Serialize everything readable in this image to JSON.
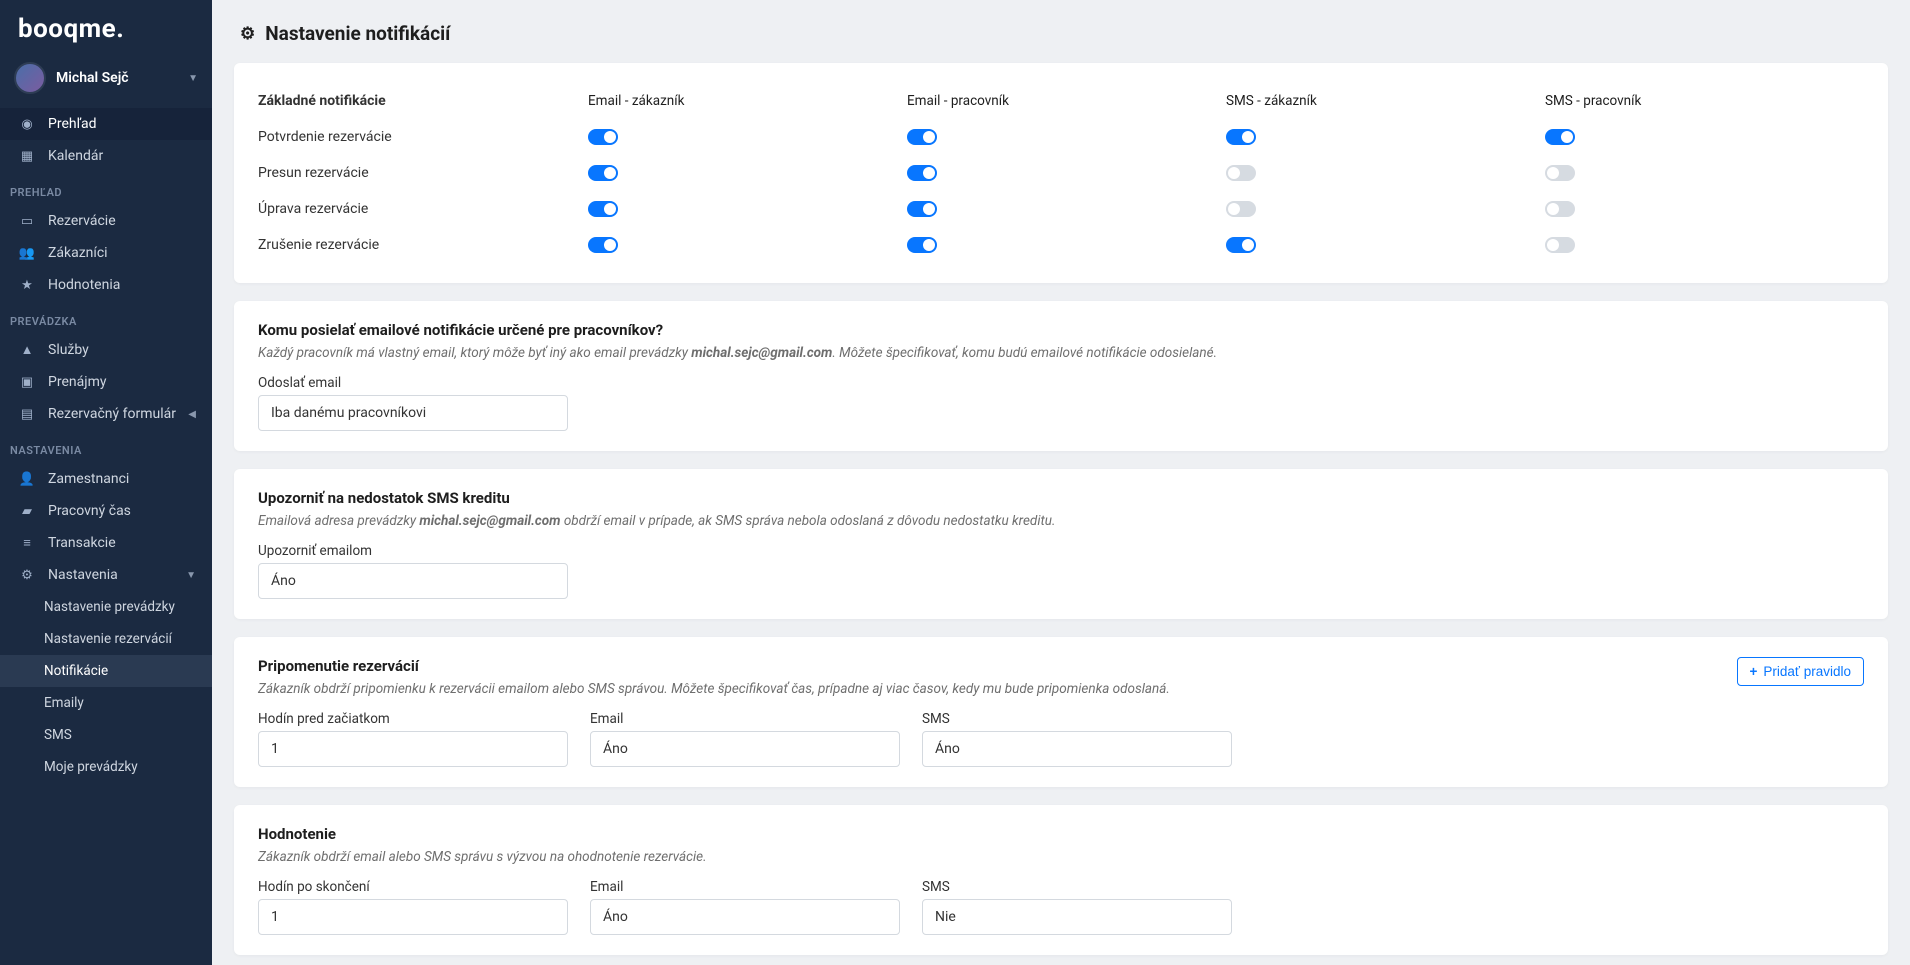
{
  "brand": "booqme.",
  "user": {
    "name": "Michal Sejč"
  },
  "nav": {
    "overview": "Prehľad",
    "calendar": "Kalendár",
    "sec_prehlad": "PREHĽAD",
    "reservations": "Rezervácie",
    "customers": "Zákazníci",
    "ratings": "Hodnotenia",
    "sec_prevadzka": "PREVÁDZKA",
    "services": "Služby",
    "rentals": "Prenájmy",
    "resform": "Rezervačný formulár",
    "sec_nastavenia": "NASTAVENIA",
    "employees": "Zamestnanci",
    "worktime": "Pracovný čas",
    "transactions": "Transakcie",
    "settings": "Nastavenia",
    "sub_prev": "Nastavenie prevádzky",
    "sub_res": "Nastavenie rezervácií",
    "sub_notif": "Notifikácie",
    "sub_emails": "Emaily",
    "sub_sms": "SMS",
    "sub_my": "Moje prevádzky"
  },
  "page": {
    "title": "Nastavenie notifikácií"
  },
  "basic": {
    "heading": "Základné notifikácie",
    "col_email_cust": "Email - zákazník",
    "col_email_emp": "Email - pracovník",
    "col_sms_cust": "SMS - zákazník",
    "col_sms_emp": "SMS - pracovník",
    "rows": [
      {
        "label": "Potvrdenie rezervácie",
        "v": [
          true,
          true,
          true,
          true
        ]
      },
      {
        "label": "Presun rezervácie",
        "v": [
          true,
          true,
          false,
          false
        ]
      },
      {
        "label": "Úprava rezervácie",
        "v": [
          true,
          true,
          false,
          false
        ]
      },
      {
        "label": "Zrušenie rezervácie",
        "v": [
          true,
          true,
          true,
          false
        ]
      }
    ]
  },
  "emailWho": {
    "heading": "Komu posielať emailové notifikácie určené pre pracovníkov?",
    "desc_pre": "Každý pracovník má vlastný email, ktorý môže byť iný ako email prevádzky ",
    "desc_email": "michal.sejc@gmail.com",
    "desc_post": ". Môžete špecifikovať, komu budú emailové notifikácie odosielané.",
    "label": "Odoslať email",
    "value": "Iba danému pracovníkovi"
  },
  "smsCredit": {
    "heading": "Upozorniť na nedostatok SMS kreditu",
    "desc_pre": "Emailová adresa prevádzky ",
    "desc_email": "michal.sejc@gmail.com",
    "desc_post": " obdrží email v prípade, ak SMS správa nebola odoslaná z dôvodu nedostatku kreditu.",
    "label": "Upozorniť emailom",
    "value": "Áno"
  },
  "reminder": {
    "heading": "Pripomenutie rezervácií",
    "desc": "Zákazník obdrží pripomienku k rezervácii emailom alebo SMS správou. Môžete špecifikovať čas, prípadne aj viac časov, kedy mu bude pripomienka odoslaná.",
    "btn": "Pridať pravidlo",
    "hours_label": "Hodín pred začiatkom",
    "hours_value": "1",
    "email_label": "Email",
    "email_value": "Áno",
    "sms_label": "SMS",
    "sms_value": "Áno"
  },
  "rating": {
    "heading": "Hodnotenie",
    "desc": "Zákazník obdrží email alebo SMS správu s výzvou na ohodnotenie rezervácie.",
    "hours_label": "Hodín po skončení",
    "hours_value": "1",
    "email_label": "Email",
    "email_value": "Áno",
    "sms_label": "SMS",
    "sms_value": "Nie"
  }
}
